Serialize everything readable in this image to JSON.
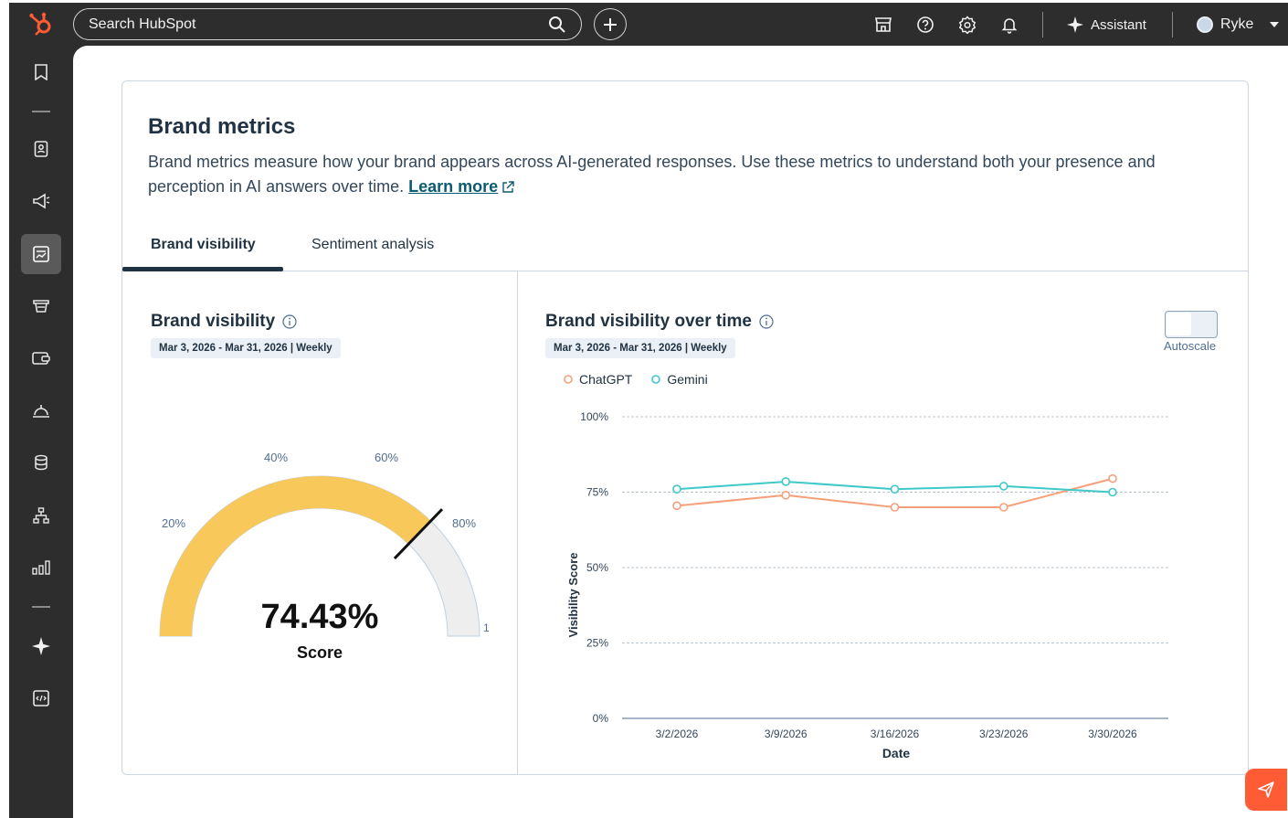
{
  "topbar": {
    "search_placeholder": "Search HubSpot",
    "assistant_label": "Assistant",
    "user_name": "Ryke",
    "brand_color": "#ff5c35"
  },
  "sidenav": {
    "icons": [
      "bookmark-icon",
      "contacts-icon",
      "marketing-icon",
      "reporting-icon",
      "sales-icon",
      "commerce-icon",
      "service-icon",
      "data-icon",
      "automation-icon",
      "analytics-icon",
      "breeze-icon",
      "developer-icon"
    ],
    "active_item": "reporting-icon"
  },
  "page": {
    "title": "Brand metrics",
    "description": "Brand metrics measure how your brand appears across AI-generated responses. Use these metrics to understand both your presence and perception in AI answers over time.",
    "learn_more": "Learn more",
    "tabs": [
      {
        "label": "Brand visibility",
        "active": true
      },
      {
        "label": "Sentiment analysis",
        "active": false
      }
    ]
  },
  "gauge_panel": {
    "title": "Brand visibility",
    "date_range": "Mar 3, 2026 - Mar 31, 2026 | Weekly",
    "score_value": "74.43%",
    "score_label": "Score",
    "gauge_value": 0.7443,
    "tick_labels": [
      "20%",
      "40%",
      "60%",
      "80%",
      "1"
    ],
    "fill_color": "#f8c85a",
    "track_color": "#eeeeee"
  },
  "chart_panel": {
    "title": "Brand visibility over time",
    "date_range": "Mar 3, 2026 - Mar 31, 2026 | Weekly",
    "autoscale_label": "Autoscale"
  },
  "chart_data": {
    "type": "line",
    "title": "Brand visibility over time",
    "xlabel": "Date",
    "ylabel": "Visibility Score",
    "categories": [
      "3/2/2026",
      "3/9/2026",
      "3/16/2026",
      "3/23/2026",
      "3/30/2026"
    ],
    "ylim": [
      0,
      100
    ],
    "yticks": [
      "0%",
      "25%",
      "50%",
      "75%",
      "100%"
    ],
    "grid": true,
    "legend": "top-left",
    "series": [
      {
        "name": "ChatGPT",
        "color": "#f5a07a",
        "values": [
          70.5,
          74,
          70,
          70,
          79.5
        ]
      },
      {
        "name": "Gemini",
        "color": "#3fc8c8",
        "values": [
          76,
          78.5,
          76,
          77,
          75
        ]
      }
    ]
  }
}
